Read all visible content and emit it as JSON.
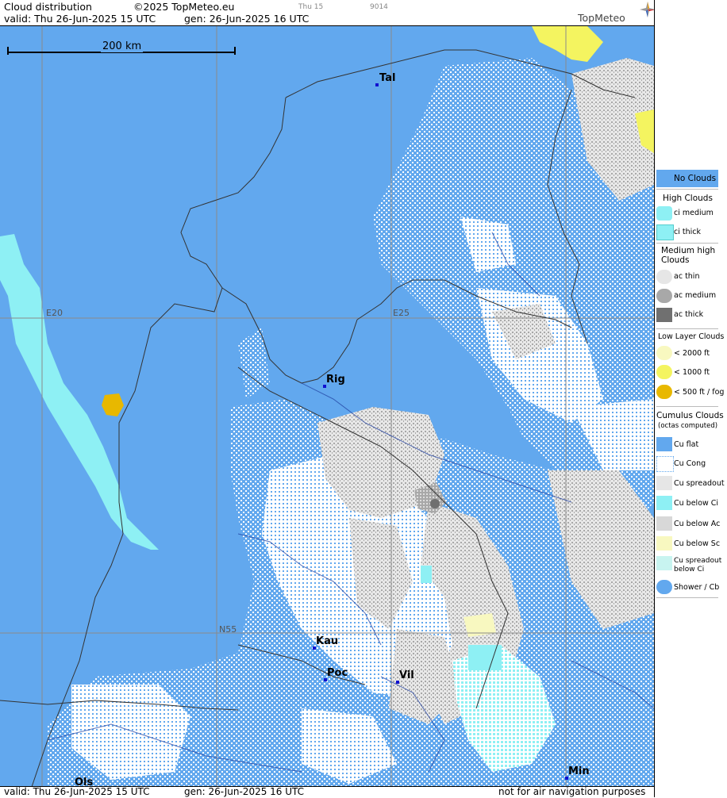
{
  "header": {
    "title": "Cloud distribution",
    "copyright": "©2025 TopMeteo.eu",
    "tab_small_1": "Thu 15",
    "tab_small_2": "9014",
    "valid": "valid:  Thu  26-Jun-2025  15 UTC",
    "gen": "gen:  26-Jun-2025 16 UTC",
    "logo": "TopMeteo"
  },
  "map": {
    "scale_label": "200 km",
    "grid_labels": {
      "e20": "E20",
      "e25": "E25",
      "n55": "N55"
    },
    "cities": [
      {
        "name": "Tal"
      },
      {
        "name": "Rig"
      },
      {
        "name": "Kau"
      },
      {
        "name": "Poc"
      },
      {
        "name": "Vil"
      },
      {
        "name": "Min"
      },
      {
        "name": "Ols"
      }
    ]
  },
  "footer": {
    "valid": "valid:  Thu  26-Jun-2025  15 UTC",
    "gen": "gen:  26-Jun-2025 16 UTC",
    "disclaimer": "not for air navigation purposes"
  },
  "legend": {
    "no_clouds": "No Clouds",
    "high_title": "High Clouds",
    "ci_medium": "ci medium",
    "ci_thick": "ci thick",
    "medium_title": "Medium high Clouds",
    "ac_thin": "ac thin",
    "ac_medium": "ac medium",
    "ac_thick": "ac thick",
    "low_title": "Low Layer Clouds",
    "low_2000": "< 2000 ft",
    "low_1000": "< 1000 ft",
    "low_500": "< 500 ft / fog",
    "cu_title": "Cumulus Clouds",
    "cu_sub": "(octas computed)",
    "cu_flat": "Cu flat",
    "cu_cong": "Cu Cong",
    "cu_spreadout": "Cu spreadout",
    "cu_below_ci": "Cu below Ci",
    "cu_below_ac": "Cu below Ac",
    "cu_below_sc": "Cu below Sc",
    "cu_spread_below_ci": "Cu spreadout below Ci",
    "shower": "Shower / Cb"
  },
  "colors": {
    "no_clouds": "#62a8ee",
    "ci": "#8ef0f4",
    "ac_thin": "#e6e6e6",
    "ac_medium": "#a8a8a8",
    "ac_thick": "#707070",
    "low_2000": "#f8f8c0",
    "low_1000": "#f4f460",
    "low_500": "#e8b800",
    "cu_white": "#ffffff"
  }
}
